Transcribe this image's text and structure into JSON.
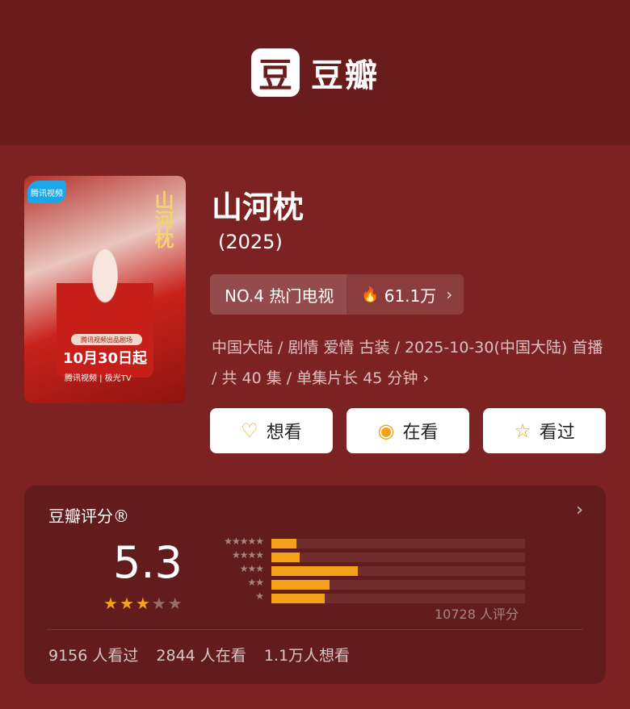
{
  "header": {
    "logo_char": "豆",
    "brand": "豆瓣"
  },
  "poster": {
    "badge": "腾讯视频",
    "title_vertical": "山河枕",
    "pill": "腾讯视频出品剧场",
    "date": "10月30日起",
    "brand_line": "腾讯视频 | 极光TV"
  },
  "show": {
    "title": "山河枕",
    "year": "(2025)",
    "rank_label": "NO.4 热门电视",
    "heat": "61.1万",
    "meta": "中国大陆 / 剧情 爱情 古装 / 2025-10-30(中国大陆) 首播 / 共 40 集 / 单集片长 45 分钟"
  },
  "actions": [
    {
      "label": "想看",
      "icon": "heart-plus-icon",
      "glyph": "♡"
    },
    {
      "label": "在看",
      "icon": "target-icon",
      "glyph": "◉"
    },
    {
      "label": "看过",
      "icon": "star-outline-icon",
      "glyph": "☆"
    }
  ],
  "rating": {
    "label": "豆瓣评分®",
    "score": "5.3",
    "stars_value": 2.5,
    "votes": "10728 人评分",
    "distribution": [
      {
        "stars": "★★★★★",
        "fraction": 0.1
      },
      {
        "stars": "★★★★",
        "fraction": 0.11
      },
      {
        "stars": "★★★",
        "fraction": 0.34
      },
      {
        "stars": "★★",
        "fraction": 0.23
      },
      {
        "stars": "★",
        "fraction": 0.21
      }
    ],
    "watched": "9156 人看过",
    "watching": "2844 人在看",
    "want": "1.1万人想看"
  },
  "colors": {
    "accent": "#f6a11a",
    "background": "#7c2222",
    "header": "#6a1c1d"
  }
}
